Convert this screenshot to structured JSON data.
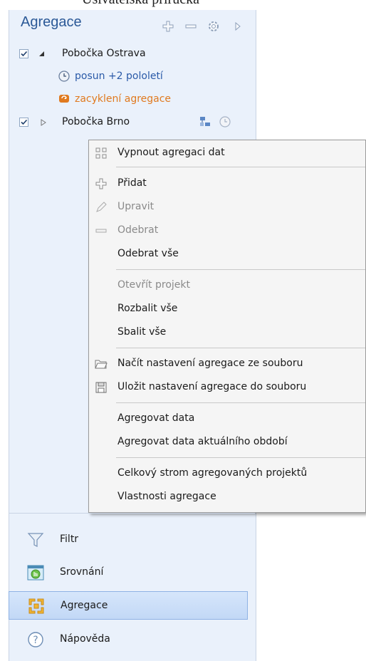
{
  "window": {
    "title_partial": "Ušivatelská příručka"
  },
  "panel": {
    "title": "Agregace",
    "header_icons": [
      "plus-icon",
      "minus-icon",
      "gear-icon",
      "collapse-arrow-icon"
    ]
  },
  "tree": {
    "items": [
      {
        "label": "Pobočka Ostrava",
        "checked": true,
        "expanded": true
      },
      {
        "label": "posun +2 pololetí",
        "icon": "clock-icon"
      },
      {
        "label": "zacyklení agregace",
        "icon": "cycle-warning-icon"
      },
      {
        "label": "Pobočka Brno",
        "checked": true,
        "expanded": false,
        "icons": [
          "network-icon",
          "clock-icon"
        ]
      }
    ]
  },
  "context_menu": {
    "items": [
      {
        "label": "Vypnout agregaci dat",
        "icon": "aggregation-off-icon",
        "enabled": true
      },
      {
        "label": "Přidat",
        "icon": "plus-icon",
        "enabled": true
      },
      {
        "label": "Upravit",
        "icon": "pencil-icon",
        "enabled": false
      },
      {
        "label": "Odebrat",
        "icon": "minus-icon",
        "enabled": false
      },
      {
        "label": "Odebrat vše",
        "enabled": true
      },
      {
        "label": "Otevřít projekt",
        "enabled": false
      },
      {
        "label": "Rozbalit vše",
        "enabled": true
      },
      {
        "label": "Sbalit vše",
        "enabled": true
      },
      {
        "label": "Načít nastavení agregace ze souboru",
        "icon": "folder-icon",
        "enabled": true
      },
      {
        "label": "Uložit nastavení agregace do souboru",
        "icon": "save-icon",
        "enabled": true
      },
      {
        "label": "Agregovat data",
        "enabled": true
      },
      {
        "label": "Agregovat data aktuálního období",
        "enabled": true
      },
      {
        "label": "Celkový strom agregovaných projektů",
        "enabled": true
      },
      {
        "label": "Vlastnosti agregace",
        "enabled": true
      }
    ]
  },
  "nav": {
    "items": [
      {
        "label": "Filtr",
        "icon": "filter-icon",
        "selected": false
      },
      {
        "label": "Srovnání",
        "icon": "comparison-icon",
        "selected": false
      },
      {
        "label": "Agregace",
        "icon": "aggregation-icon",
        "selected": true
      },
      {
        "label": "Nápověda",
        "icon": "help-icon",
        "selected": false
      }
    ]
  },
  "colors": {
    "panel_bg": "#eaf1fb",
    "title_blue": "#2b5997",
    "link_blue": "#2a5aa8",
    "warning_orange": "#e07a1f",
    "selected_nav": "#c2d8f6"
  }
}
